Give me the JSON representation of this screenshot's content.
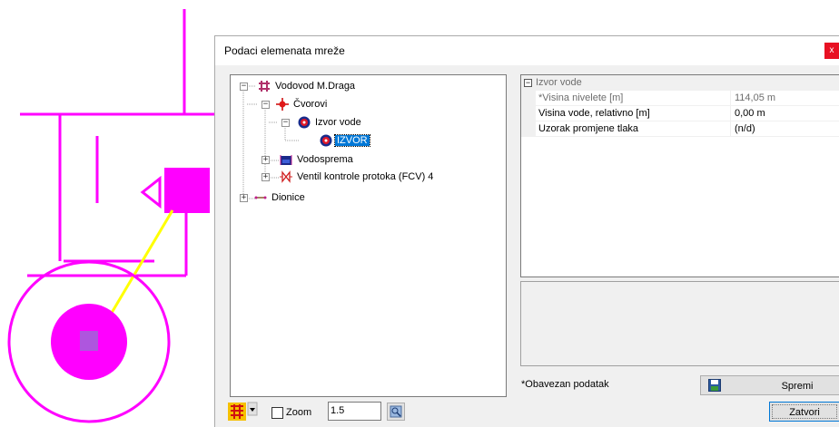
{
  "dialog": {
    "title": "Podaci elemenata mreže",
    "close_label": "x"
  },
  "tree": {
    "root": {
      "label": "Vodovod M.Draga",
      "expander": "−"
    },
    "cvorovi": {
      "label": "Čvorovi",
      "expander": "−"
    },
    "izvor_vode": {
      "label": "Izvor vode",
      "expander": "−"
    },
    "izvor": {
      "label": "IZVOR",
      "selected": true
    },
    "vodosprema": {
      "label": "Vodosprema",
      "expander": "+"
    },
    "ventil": {
      "label": "Ventil kontrole protoka (FCV) 4",
      "expander": "+"
    },
    "dionice": {
      "label": "Dionice",
      "expander": "+"
    }
  },
  "properties": {
    "category": "Izvor vode",
    "collapse": "−",
    "rows": [
      {
        "name": "*Visina nivelete [m]",
        "value": "114,05 m"
      },
      {
        "name": "Visina vode, relativno [m]",
        "value": "0,00 m"
      },
      {
        "name": "Uzorak promjene tlaka",
        "value": "(n/d)"
      }
    ]
  },
  "footer": {
    "required_note": "*Obavezan podatak",
    "save_label": "Spremi",
    "close_label": "Zatvori",
    "zoom_label": "Zoom",
    "zoom_checked": false,
    "zoom_value": "1.5"
  },
  "colors": {
    "magenta": "#ff00ff",
    "yellow": "#ffff00",
    "selection": "#0078d7",
    "close_red": "#e81123"
  }
}
